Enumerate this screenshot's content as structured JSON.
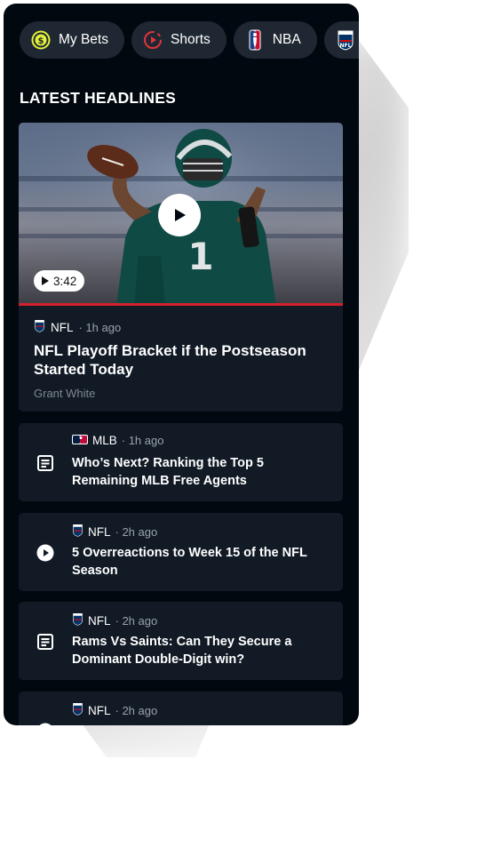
{
  "chips": [
    {
      "label": "My Bets",
      "icon": "dollar-icon"
    },
    {
      "label": "Shorts",
      "icon": "shorts-play-icon"
    },
    {
      "label": "NBA",
      "icon": "nba-logo-icon"
    },
    {
      "label": "",
      "icon": "nfl-logo-icon"
    }
  ],
  "section": {
    "title": "LATEST HEADLINES"
  },
  "hero": {
    "duration": "3:42",
    "league": "NFL",
    "time": "· 1h ago",
    "title": "NFL Playoff Bracket if the Postseason Started Today",
    "author": "Grant White"
  },
  "articles": [
    {
      "type": "article",
      "icon": "article-icon",
      "league": "MLB",
      "time": "· 1h ago",
      "title": "Who’s Next? Ranking the Top 5 Remaining MLB Free Agents"
    },
    {
      "type": "video",
      "icon": "play-icon",
      "league": "NFL",
      "time": "· 2h ago",
      "title": "5 Overreactions to Week 15 of the NFL Season"
    },
    {
      "type": "article",
      "icon": "article-icon",
      "league": "NFL",
      "time": "· 2h ago",
      "title": "Rams Vs Saints: Can They Secure a Dominant Double-Digit win?"
    },
    {
      "type": "video",
      "icon": "play-icon",
      "league": "NFL",
      "time": "· 2h ago",
      "title": ""
    }
  ],
  "colors": {
    "background": "#02080f",
    "card": "#111a25",
    "chip": "#1f2832",
    "accent_red": "#d4202c",
    "money_yellow": "#e4f23a"
  }
}
